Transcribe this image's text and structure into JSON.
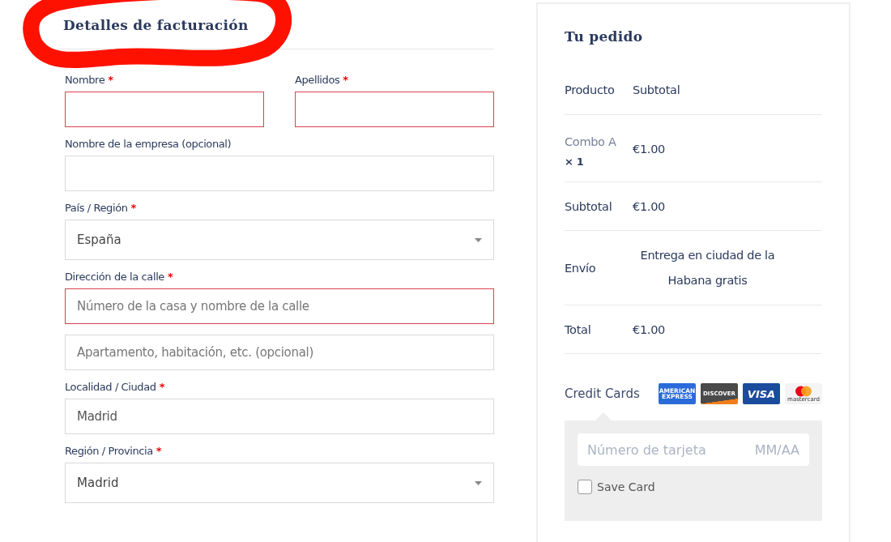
{
  "billing": {
    "heading": "Detalles de facturación",
    "heading_circled": true,
    "rows": [
      {
        "fields": [
          {
            "kind": "text",
            "label": "Nombre",
            "required_mark": "*",
            "invalid": true
          },
          {
            "kind": "text",
            "label": "Apellidos",
            "required_mark": "*",
            "invalid": true
          }
        ]
      },
      {
        "fields": [
          {
            "kind": "text",
            "label": "Nombre de la empresa (opcional)",
            "invalid": false
          }
        ]
      },
      {
        "fields": [
          {
            "kind": "select",
            "label": "País / Región",
            "required_mark": "*",
            "invalid": false,
            "value": "España"
          }
        ]
      },
      {
        "fields": [
          {
            "kind": "text",
            "label": "Dirección de la calle",
            "required_mark": "*",
            "invalid": true,
            "placeholder": "Número de la casa y nombre de la calle"
          }
        ]
      },
      {
        "fields": [
          {
            "kind": "text",
            "invalid": false,
            "placeholder": "Apartamento, habitación, etc. (opcional)"
          }
        ]
      },
      {
        "fields": [
          {
            "kind": "text",
            "label": "Localidad / Ciudad",
            "required_mark": "*",
            "invalid": false,
            "value": "Madrid"
          }
        ]
      },
      {
        "fields": [
          {
            "kind": "select",
            "label": "Región / Provincia",
            "required_mark": "*",
            "invalid": false,
            "value": "Madrid"
          }
        ]
      }
    ]
  },
  "order": {
    "heading": "Tu pedido",
    "columns": [
      "Producto",
      "Subtotal"
    ],
    "rows": [
      {
        "kind": "item",
        "name": "Combo A",
        "quantity": "× 1",
        "value": "€1.00"
      },
      {
        "kind": "total",
        "label": "Subtotal",
        "value": "€1.00"
      },
      {
        "kind": "total",
        "label": "Envío",
        "value": "Entrega en ciudad de la Habana gratis"
      },
      {
        "kind": "total",
        "label": "Total",
        "value": "€1.00"
      }
    ],
    "payment": {
      "label": "Credit Cards",
      "logos": [
        {
          "kind": "amex",
          "lines": [
            "AMERICAN",
            "EXPRESS"
          ]
        },
        {
          "kind": "discover",
          "lines": [
            "DISCOVER"
          ]
        },
        {
          "kind": "visa",
          "lines": [
            "VISA"
          ]
        },
        {
          "kind": "mastercard",
          "lines": [
            "mastercard"
          ]
        }
      ],
      "card_placeholder": "Número de tarjeta",
      "expiry_placeholder": "MM/AA",
      "save_card": {
        "label": "Save Card",
        "checked": false
      }
    }
  }
}
